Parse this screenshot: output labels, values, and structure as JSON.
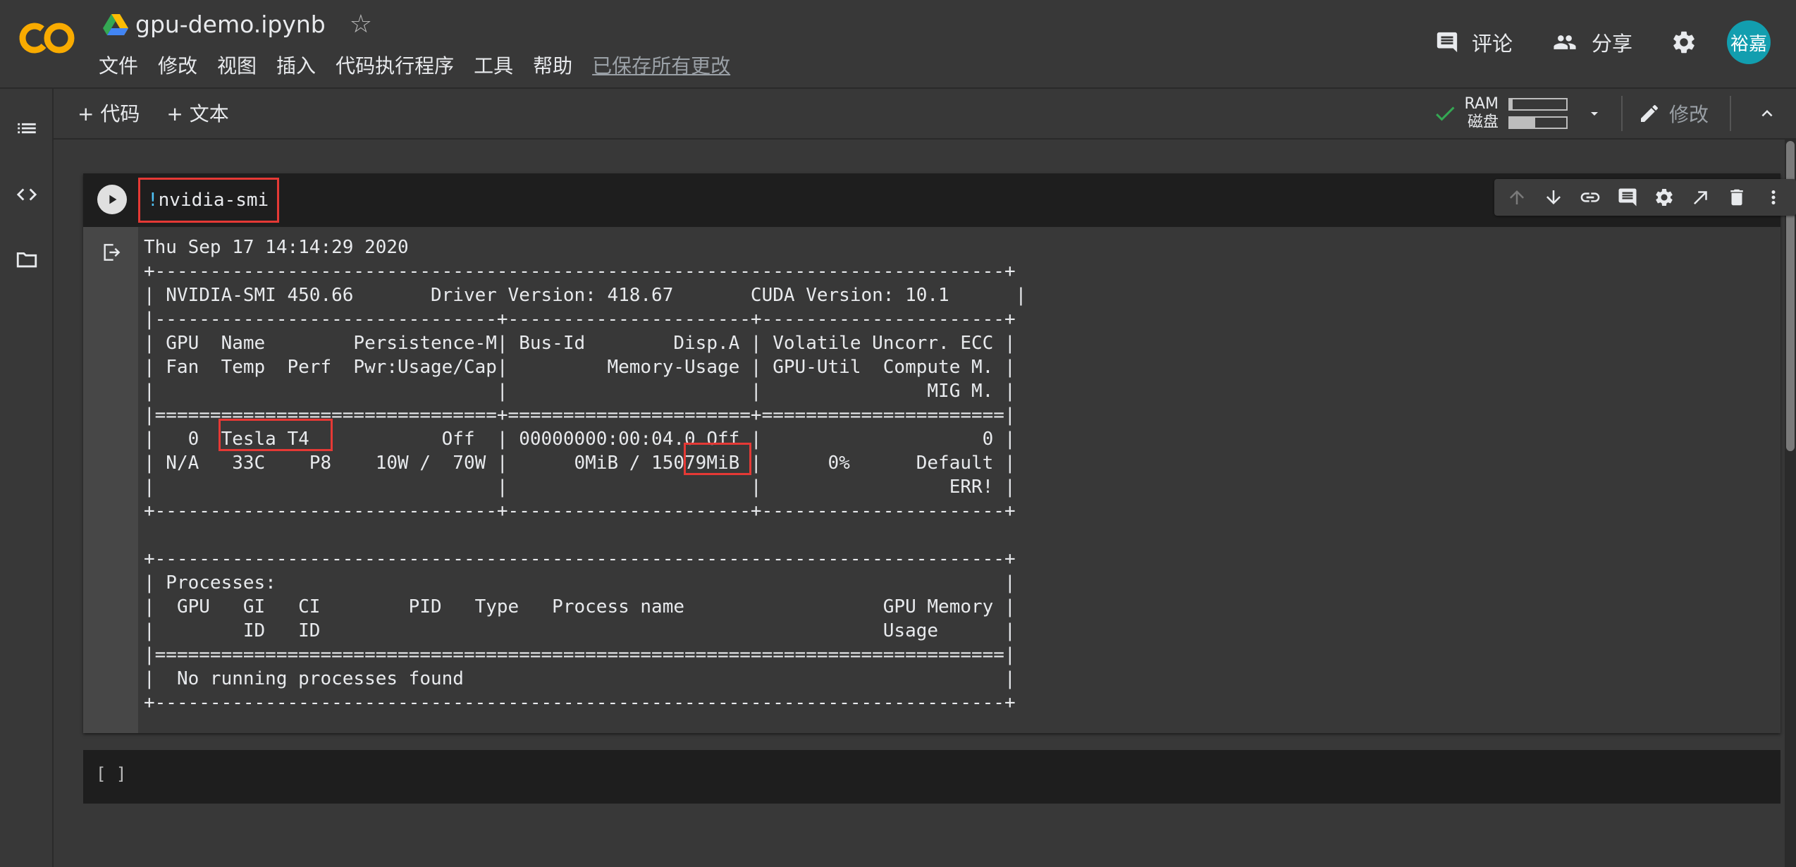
{
  "header": {
    "title": "gpu-demo.ipynb",
    "menu": [
      "文件",
      "修改",
      "视图",
      "插入",
      "代码执行程序",
      "工具",
      "帮助"
    ],
    "saved_status": "已保存所有更改",
    "comment_label": "评论",
    "share_label": "分享",
    "avatar_text": "裕嘉"
  },
  "toolbar": {
    "add_code": "+ 代码",
    "add_text": "+ 文本",
    "ram_label": "RAM",
    "disk_label": "磁盘",
    "ram_usage": 0.05,
    "disk_usage": 0.45,
    "edit_label": "修改"
  },
  "cell1": {
    "code_bang": "!",
    "code_cmd": "nvidia-smi",
    "output": "Thu Sep 17 14:14:29 2020\n+-----------------------------------------------------------------------------+\n| NVIDIA-SMI 450.66       Driver Version: 418.67       CUDA Version: 10.1      |\n|-------------------------------+----------------------+----------------------+\n| GPU  Name        Persistence-M| Bus-Id        Disp.A | Volatile Uncorr. ECC |\n| Fan  Temp  Perf  Pwr:Usage/Cap|         Memory-Usage | GPU-Util  Compute M. |\n|                               |                      |               MIG M. |\n|===============================+======================+======================|\n|   0  Tesla T4            Off  | 00000000:00:04.0 Off |                    0 |\n| N/A   33C    P8    10W /  70W |      0MiB / 15079MiB |      0%      Default |\n|                               |                      |                 ERR! |\n+-------------------------------+----------------------+----------------------+\n\n+-----------------------------------------------------------------------------+\n| Processes:                                                                  |\n|  GPU   GI   CI        PID   Type   Process name                  GPU Memory |\n|        ID   ID                                                   Usage      |\n|=============================================================================|\n|  No running processes found                                                 |\n+-----------------------------------------------------------------------------+"
  },
  "cell2": {
    "label": "[ ]"
  },
  "colors": {
    "accent_orange": "#f9ab00",
    "highlight_red": "#e53935",
    "check_green": "#34a853",
    "avatar_teal": "#129eaf"
  }
}
